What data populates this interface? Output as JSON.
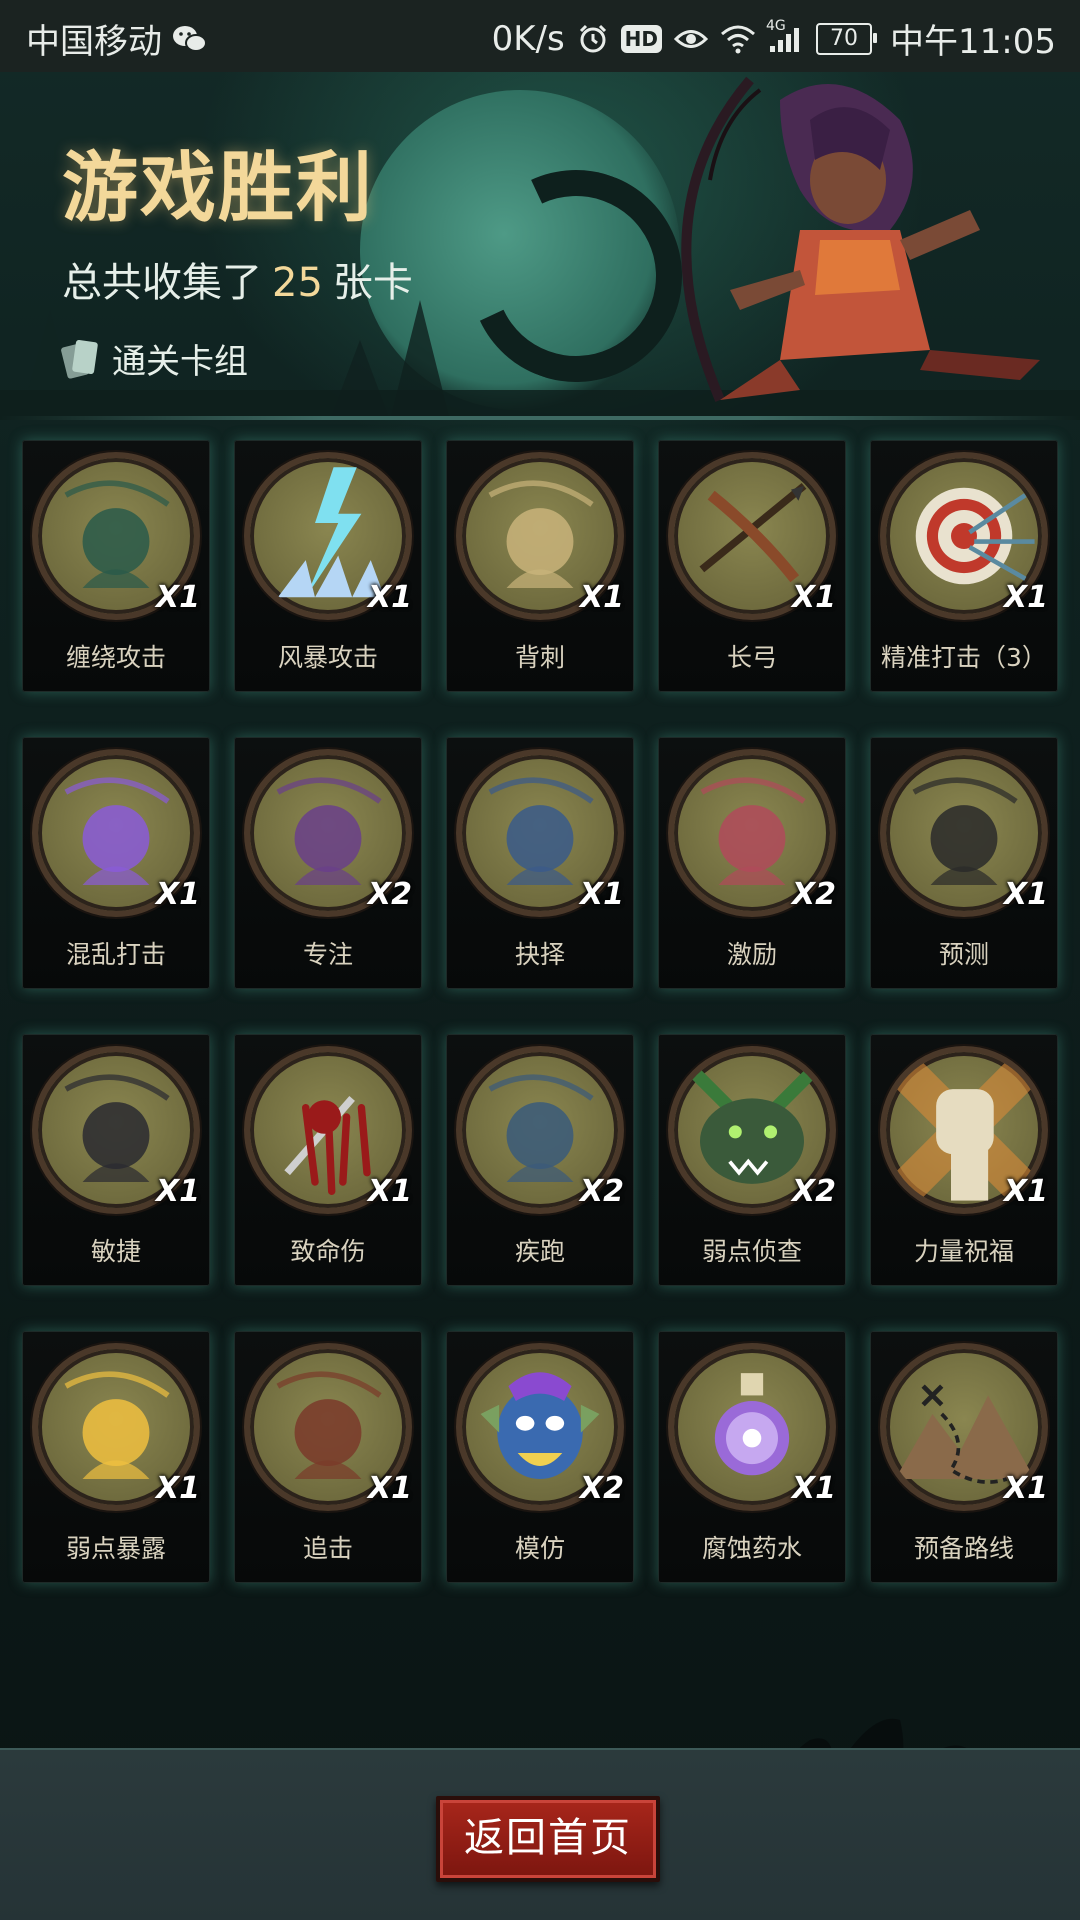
{
  "status_bar": {
    "carrier": "中国移动",
    "net_speed": "0K/s",
    "hd": "HD",
    "network_type": "4G",
    "battery": "70",
    "time": "中午11:05",
    "icons": [
      "wechat-icon",
      "alarm-icon",
      "hd-icon",
      "eye-icon",
      "wifi-icon",
      "signal-icon",
      "battery-icon"
    ]
  },
  "header": {
    "title": "游戏胜利",
    "collected_prefix": "总共收集了",
    "collected_count": "25",
    "collected_suffix": "张卡",
    "deck_link": "通关卡组"
  },
  "cards": [
    {
      "name": "缠绕攻击",
      "qty": "X1",
      "art": "thorn-vine-icon",
      "accent": "#2a5a4a"
    },
    {
      "name": "风暴攻击",
      "qty": "X1",
      "art": "lightning-storm-icon",
      "accent": "#7fe0f0"
    },
    {
      "name": "背刺",
      "qty": "X1",
      "art": "backstab-dummy-icon",
      "accent": "#c9b37a"
    },
    {
      "name": "长弓",
      "qty": "X1",
      "art": "longbow-icon",
      "accent": "#8a4a2a"
    },
    {
      "name": "精准打击（3）",
      "qty": "X1",
      "art": "target-arrows-icon",
      "accent": "#c0392b"
    },
    {
      "name": "混乱打击",
      "qty": "X1",
      "art": "purple-crystal-icon",
      "accent": "#8a5bd8"
    },
    {
      "name": "专注",
      "qty": "X2",
      "art": "wizard-icon",
      "accent": "#6a3f8a"
    },
    {
      "name": "抉择",
      "qty": "X1",
      "art": "old-sage-icon",
      "accent": "#3a5a8a"
    },
    {
      "name": "激励",
      "qty": "X2",
      "art": "hammer-warrior-icon",
      "accent": "#b04a5a"
    },
    {
      "name": "预测",
      "qty": "X1",
      "art": "witch-icon",
      "accent": "#2a2a2a"
    },
    {
      "name": "敏捷",
      "qty": "X1",
      "art": "panther-icon",
      "accent": "#2a2a30"
    },
    {
      "name": "致命伤",
      "qty": "X1",
      "art": "bleeding-dagger-icon",
      "accent": "#9a1a1a"
    },
    {
      "name": "疾跑",
      "qty": "X2",
      "art": "running-beast-icon",
      "accent": "#3a5a7a"
    },
    {
      "name": "弱点侦查",
      "qty": "X2",
      "art": "wolf-icon",
      "accent": "#3a5a3a"
    },
    {
      "name": "力量祝福",
      "qty": "X1",
      "art": "fist-icon",
      "accent": "#d98a3a"
    },
    {
      "name": "弱点暴露",
      "qty": "X1",
      "art": "pierced-boot-icon",
      "accent": "#f0c040"
    },
    {
      "name": "追击",
      "qty": "X1",
      "art": "hooded-runner-icon",
      "accent": "#7a3a2a"
    },
    {
      "name": "模仿",
      "qty": "X2",
      "art": "goblin-face-icon",
      "accent": "#3a6ab0"
    },
    {
      "name": "腐蚀药水",
      "qty": "X1",
      "art": "potion-icon",
      "accent": "#9a6ad8"
    },
    {
      "name": "预备路线",
      "qty": "X1",
      "art": "treasure-map-icon",
      "accent": "#8a6a4a"
    }
  ],
  "footer": {
    "home_button": "返回首页"
  }
}
